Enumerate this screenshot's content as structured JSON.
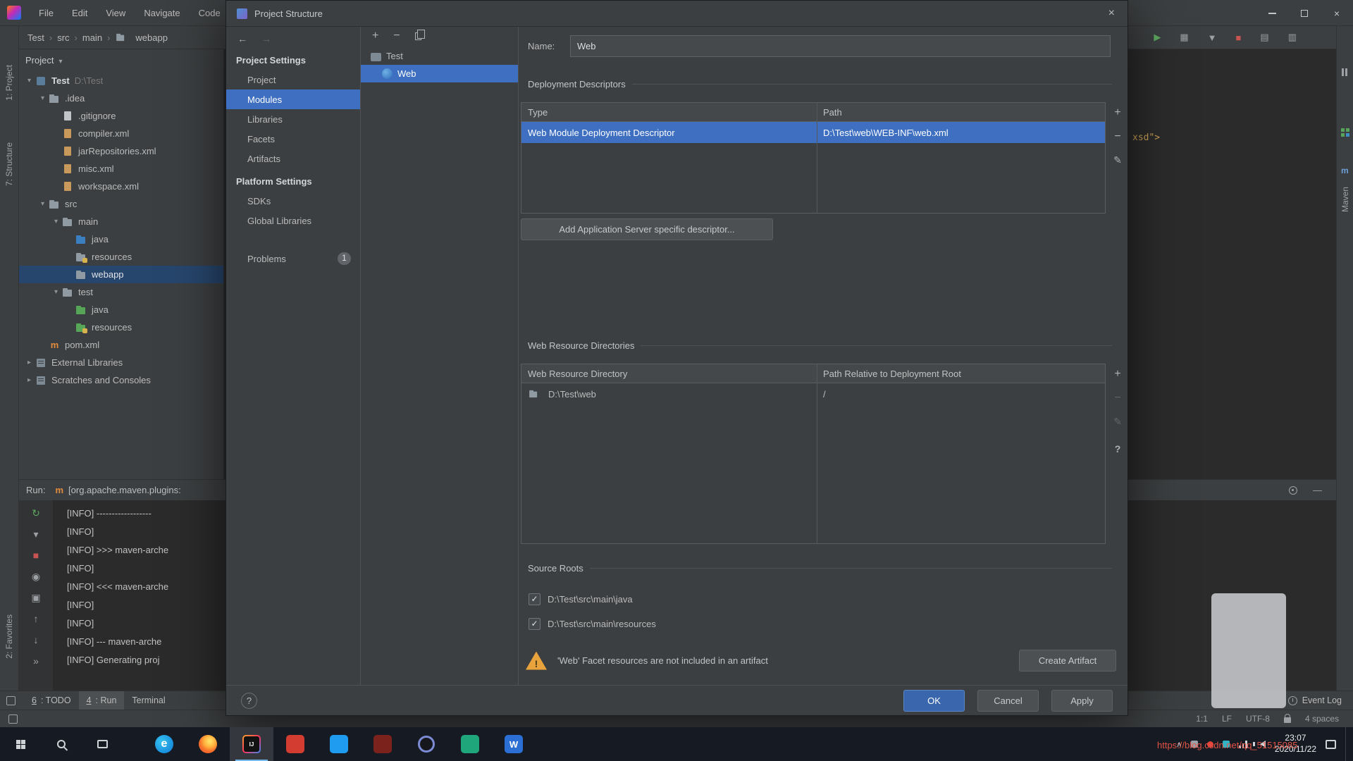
{
  "ide": {
    "menu": [
      "File",
      "Edit",
      "View",
      "Navigate",
      "Code"
    ],
    "breadcrumbs": [
      {
        "label": "Test"
      },
      {
        "label": "src"
      },
      {
        "label": "main"
      },
      {
        "label": "webapp",
        "icon": "folder-icon"
      }
    ],
    "window_controls": {
      "close": "×"
    },
    "toolbar_icons": [
      "run-icon",
      "build-icon",
      "debug-icon",
      "stop-icon",
      "structure-icon",
      "search-icon"
    ],
    "tool_strips": {
      "left": [
        "1: Project",
        "7: Structure",
        "2: Favorites"
      ],
      "right_label": "Maven"
    },
    "project_panel": {
      "header": "Project",
      "tree": [
        {
          "label": "Test",
          "suffix": "D:\\Test",
          "indent": 0,
          "chevron": "expanded",
          "icon": "project-icon",
          "bold": true
        },
        {
          "label": ".idea",
          "indent": 1,
          "chevron": "expanded",
          "icon": "folder-icon"
        },
        {
          "label": ".gitignore",
          "indent": 2,
          "icon": "file-icon"
        },
        {
          "label": "compiler.xml",
          "indent": 2,
          "icon": "xml-icon"
        },
        {
          "label": "jarRepositories.xml",
          "indent": 2,
          "icon": "xml-icon"
        },
        {
          "label": "misc.xml",
          "indent": 2,
          "icon": "xml-icon"
        },
        {
          "label": "workspace.xml",
          "indent": 2,
          "icon": "xml-icon"
        },
        {
          "label": "src",
          "indent": 1,
          "ch evron": "expanded",
          "chevron": "expanded",
          "icon": "folder-icon"
        },
        {
          "label": "main",
          "indent": 2,
          "chevron": "expanded",
          "icon": "folder-icon"
        },
        {
          "label": "java",
          "indent": 3,
          "icon": "source-folder-icon"
        },
        {
          "label": "resources",
          "indent": 3,
          "icon": "resources-folder-icon"
        },
        {
          "label": "webapp",
          "indent": 3,
          "icon": "folder-icon",
          "selected": true
        },
        {
          "label": "test",
          "indent": 2,
          "chevron": "expanded",
          "icon": "folder-icon"
        },
        {
          "label": "java",
          "indent": 3,
          "icon": "test-folder-icon"
        },
        {
          "label": "resources",
          "indent": 3,
          "icon": "test-resources-folder-icon"
        },
        {
          "label": "pom.xml",
          "indent": 1,
          "icon": "maven-icon"
        },
        {
          "label": "External Libraries",
          "indent": 0,
          "chevron": "collapsed",
          "icon": "library-icon"
        },
        {
          "label": "Scratches and Consoles",
          "indent": 0,
          "chevron": "collapsed",
          "icon": "scratch-icon"
        }
      ]
    },
    "editor": {
      "visible_code": "xsd\">"
    },
    "run_panel": {
      "label": "Run:",
      "tab": {
        "icon": "maven-icon",
        "title": "[org.apache.maven.plugins:"
      },
      "gutter_icons": [
        "rerun-icon",
        "collapse-icon",
        "stop-icon",
        "eye-icon",
        "camera-icon",
        "up-icon",
        "down-icon",
        "more-icon"
      ],
      "console_lines": [
        "[INFO] ------------------",
        "[INFO]",
        "[INFO] >>> maven-arche",
        "[INFO]",
        "[INFO] <<< maven-arche",
        "[INFO]",
        "[INFO]",
        "[INFO] --- maven-arche",
        "[INFO] Generating proj"
      ]
    },
    "bottom_bar": {
      "tabs": [
        {
          "mnemonic": "6",
          "label": ": TODO"
        },
        {
          "mnemonic": "4",
          "label": ": Run",
          "active": true
        },
        {
          "mnemonic": "",
          "label": "Terminal"
        }
      ],
      "event_log": "Event Log"
    },
    "status_bar": {
      "items": [
        "1:1",
        "LF",
        "UTF-8"
      ],
      "indent": "4 spaces"
    }
  },
  "dialog": {
    "title": "Project Structure",
    "close_glyph": "×",
    "sidebar": {
      "sections": [
        {
          "header": "Project Settings",
          "items": [
            {
              "label": "Project"
            },
            {
              "label": "Modules",
              "selected": true
            },
            {
              "label": "Libraries"
            },
            {
              "label": "Facets"
            },
            {
              "label": "Artifacts"
            }
          ]
        },
        {
          "header": "Platform Settings",
          "items": [
            {
              "label": "SDKs"
            },
            {
              "label": "Global Libraries"
            }
          ]
        },
        {
          "header": "",
          "items": [
            {
              "label": "Problems",
              "badge": "1"
            }
          ]
        }
      ]
    },
    "module_tree": [
      {
        "label": "Test",
        "icon": "module-icon",
        "indent": 0
      },
      {
        "label": "Web",
        "icon": "web-facet-icon",
        "indent": 1,
        "selected": true
      }
    ],
    "name_label": "Name:",
    "name_value": "Web",
    "deployment": {
      "title": "Deployment Descriptors",
      "columns": [
        "Type",
        "Path"
      ],
      "rows": [
        {
          "cells": [
            "Web Module Deployment Descriptor",
            "D:\\Test\\web\\WEB-INF\\web.xml"
          ],
          "selected": true
        }
      ],
      "add_button": "Add Application Server specific descriptor..."
    },
    "web_resources": {
      "title": "Web Resource Directories",
      "columns": [
        "Web Resource Directory",
        "Path Relative to Deployment Root"
      ],
      "rows": [
        {
          "cells": [
            "D:\\Test\\web",
            "/"
          ],
          "icon": "folder-icon"
        }
      ]
    },
    "source_roots": {
      "title": "Source Roots",
      "items": [
        {
          "label": "D:\\Test\\src\\main\\java",
          "checked": true
        },
        {
          "label": "D:\\Test\\src\\main\\resources",
          "checked": true
        }
      ]
    },
    "warning": {
      "glyph": "!",
      "text": "'Web' Facet resources are not included in an artifact",
      "button": "Create Artifact"
    },
    "footer": {
      "help": "?",
      "ok": "OK",
      "cancel": "Cancel",
      "apply": "Apply"
    }
  },
  "taskbar": {
    "time": "23:07",
    "date": "2020/11/22",
    "watermark": "https://blog.csdn.net/qq_51515085",
    "apps": [
      {
        "name": "start-button",
        "kind": "win"
      },
      {
        "name": "search-button",
        "kind": "mag"
      },
      {
        "name": "task-view-button",
        "kind": "tview"
      },
      {
        "name": "edge-icon",
        "kind": "circle",
        "bg": "#0d7bd4",
        "glyph": "e"
      },
      {
        "name": "firefox-icon",
        "kind": "firefox"
      },
      {
        "name": "intellij-icon",
        "kind": "idea",
        "glyph": "IJ",
        "active": true
      },
      {
        "name": "red-app-icon",
        "kind": "tile",
        "bg": "#d23c31",
        "glyph": ""
      },
      {
        "name": "vscode-icon",
        "kind": "tile",
        "bg": "#1f9cf0",
        "glyph": ""
      },
      {
        "name": "dark-app-icon",
        "kind": "tile",
        "bg": "#7c221c",
        "glyph": ""
      },
      {
        "name": "ring-app-icon",
        "kind": "ring"
      },
      {
        "name": "green-app-icon",
        "kind": "tile",
        "bg": "#1fa67a",
        "glyph": ""
      },
      {
        "name": "w-app-icon",
        "kind": "tile",
        "bg": "#2b6fd4",
        "glyph": "W"
      }
    ]
  }
}
